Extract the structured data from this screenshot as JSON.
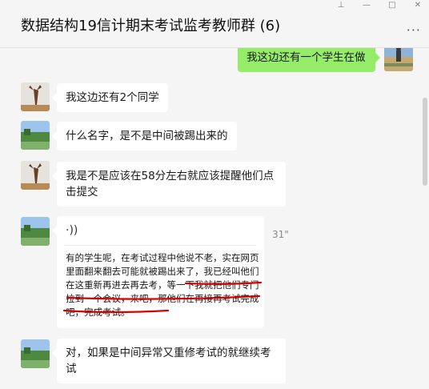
{
  "window": {
    "title": "数据结构19信计期末考试监考教师群 (6)",
    "more_label": "···"
  },
  "controls": {
    "pin_icon": "pin-icon",
    "minimize_icon": "minimize-icon",
    "maximize_icon": "maximize-icon",
    "close_icon": "close-icon",
    "pin": "⊥",
    "minimize": "—",
    "maximize": "□",
    "close": "✕"
  },
  "messages": [
    {
      "side": "right",
      "text": "我这边还有一个学生在做"
    },
    {
      "side": "left",
      "text": "我这边还有2个同学"
    },
    {
      "side": "left",
      "text": "什么名字，是不是中间被踢出来的"
    },
    {
      "side": "left",
      "text": "我是不是应该在58分左右就应该提醒他们点击提交"
    },
    {
      "side": "left",
      "type": "voice",
      "voice_symbol": "·))",
      "duration": "31\"",
      "transcript": "有的学生呢，在考试过程中他说不老，实在网页里面翻来翻去可能就被踢出来了，我已经叫他们在这重新再进去再去考，等一下我就把他们专门拉到一个会议，来吧，那他们在再接再考试完成吧，完成考试。"
    },
    {
      "side": "left",
      "text": "对，如果是中间异常又重修考试的就继续考试"
    }
  ],
  "colors": {
    "background": "#f5f5f5",
    "self_bubble": "#95ec69",
    "other_bubble": "#ffffff",
    "annotation": "#d60000"
  }
}
